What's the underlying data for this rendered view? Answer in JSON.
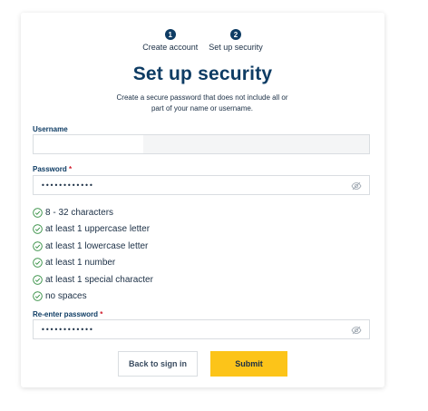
{
  "steps": [
    {
      "number": "1",
      "label": "Create account"
    },
    {
      "number": "2",
      "label": "Set up security"
    }
  ],
  "title": "Set up security",
  "subtitle": "Create a secure password that does not include all or part of your name or username.",
  "username": {
    "label": "Username",
    "value": ""
  },
  "password": {
    "label": "Password",
    "required_mark": "*",
    "value": "••••••••••••",
    "icon": "eye-slash-icon"
  },
  "rules": [
    {
      "text": "8 - 32 characters",
      "icon": "check-circle-icon"
    },
    {
      "text": "at least 1 uppercase letter",
      "icon": "check-circle-icon"
    },
    {
      "text": "at least 1 lowercase letter",
      "icon": "check-circle-icon"
    },
    {
      "text": "at least 1 number",
      "icon": "check-circle-icon"
    },
    {
      "text": "at least 1 special character",
      "icon": "check-circle-icon"
    },
    {
      "text": "no spaces",
      "icon": "check-circle-icon"
    }
  ],
  "reenter": {
    "label": "Re-enter password",
    "required_mark": "*",
    "value": "••••••••••••",
    "icon": "eye-slash-icon"
  },
  "buttons": {
    "back": "Back to sign in",
    "submit": "Submit"
  },
  "colors": {
    "primary": "#0e3c64",
    "accent": "#fcc419",
    "success": "#2e8b3d",
    "required": "#d01b2b"
  }
}
